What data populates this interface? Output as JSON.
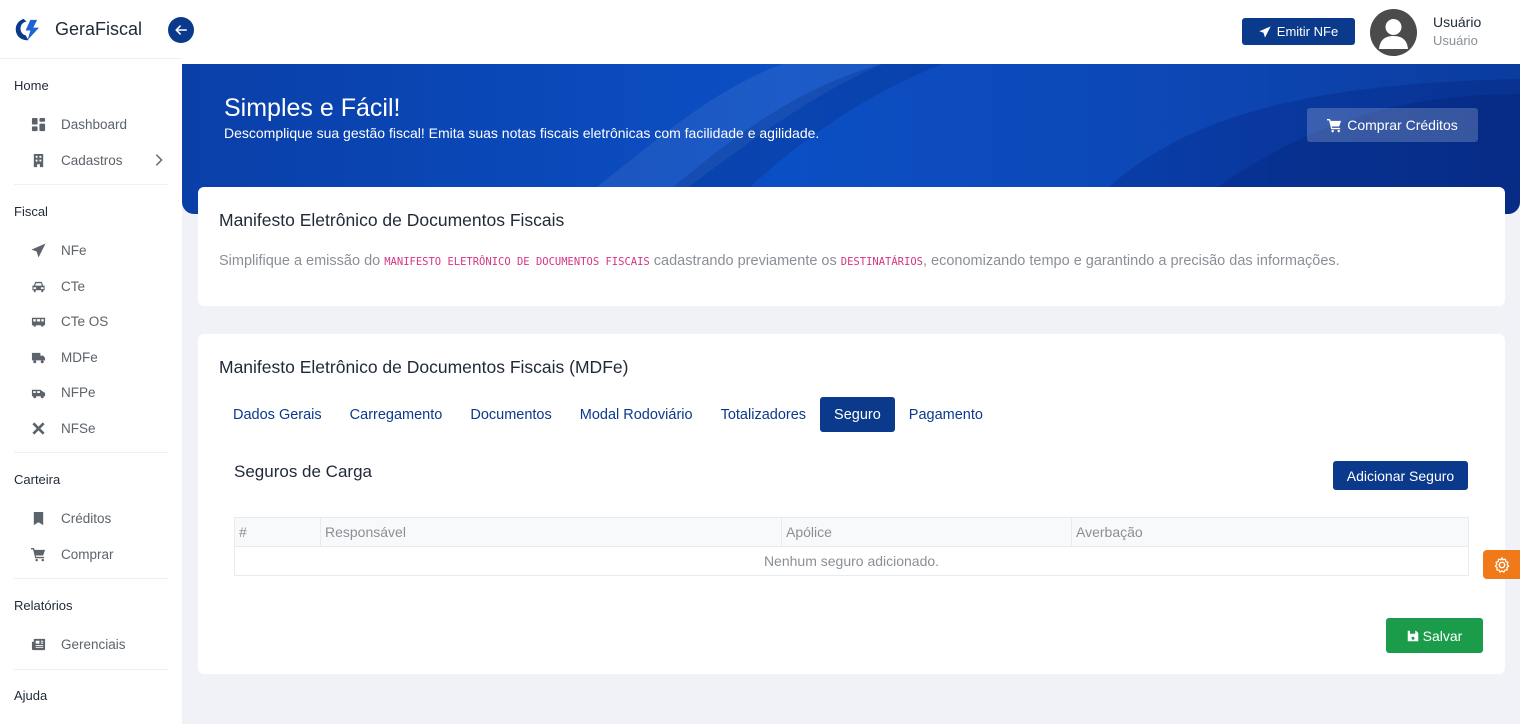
{
  "app": {
    "name": "GeraFiscal"
  },
  "sidebar": {
    "sections": [
      {
        "title": "Home",
        "items": [
          {
            "label": "Dashboard",
            "icon": "dashboard-icon"
          },
          {
            "label": "Cadastros",
            "icon": "building-icon",
            "has_submenu": true
          }
        ]
      },
      {
        "title": "Fiscal",
        "items": [
          {
            "label": "NFe",
            "icon": "paper-plane-icon"
          },
          {
            "label": "CTe",
            "icon": "car-icon"
          },
          {
            "label": "CTe OS",
            "icon": "bus-icon"
          },
          {
            "label": "MDFe",
            "icon": "truck-icon"
          },
          {
            "label": "NFPe",
            "icon": "van-icon"
          },
          {
            "label": "NFSe",
            "icon": "tools-icon"
          }
        ]
      },
      {
        "title": "Carteira",
        "items": [
          {
            "label": "Créditos",
            "icon": "bookmark-icon"
          },
          {
            "label": "Comprar",
            "icon": "cart-icon"
          }
        ]
      },
      {
        "title": "Relatórios",
        "items": [
          {
            "label": "Gerenciais",
            "icon": "newspaper-icon"
          }
        ]
      },
      {
        "title": "Ajuda",
        "items": []
      }
    ]
  },
  "topbar": {
    "emit_label": "Emitir NFe",
    "user_name": "Usuário",
    "user_role": "Usuário"
  },
  "hero": {
    "title": "Simples e Fácil!",
    "subtitle": "Descomplique sua gestão fiscal! Emita suas notas fiscais eletrônicas com facilidade e agilidade.",
    "buy_label": "Comprar Créditos"
  },
  "intro_card": {
    "title": "Manifesto Eletrônico de Documentos Fiscais",
    "desc_part1": "Simplifique a emissão do ",
    "desc_code1": "MANIFESTO ELETRÔNICO DE DOCUMENTOS FISCAIS",
    "desc_part2": " cadastrando previamente os ",
    "desc_code2": "DESTINATÁRIOS",
    "desc_part3": ", economizando tempo e garantindo a precisão das informações."
  },
  "form_card": {
    "title": "Manifesto Eletrônico de Documentos Fiscais (MDFe)",
    "tabs": [
      "Dados Gerais",
      "Carregamento",
      "Documentos",
      "Modal Rodoviário",
      "Totalizadores",
      "Seguro",
      "Pagamento"
    ],
    "active_tab": "Seguro",
    "section_title": "Seguros de Carga",
    "add_label": "Adicionar Seguro",
    "table": {
      "columns": [
        "#",
        "Responsável",
        "Apólice",
        "Averbação"
      ],
      "empty_message": "Nenhum seguro adicionado."
    },
    "save_label": "Salvar"
  },
  "colors": {
    "primary": "#0b3a8c",
    "success": "#1a9c4b",
    "settings": "#f07a1a",
    "code": "#d63384"
  }
}
